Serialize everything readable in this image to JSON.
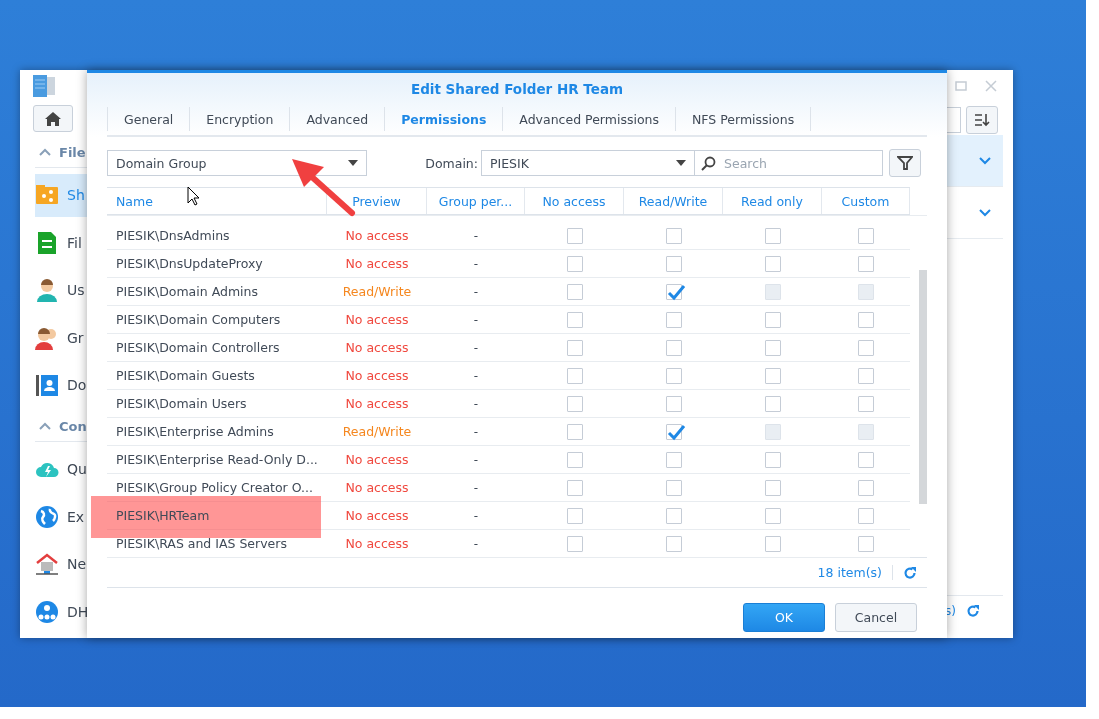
{
  "background_window": {
    "sidebar": [
      {
        "kind": "header",
        "label": "File"
      },
      {
        "kind": "item",
        "label": "Sh",
        "selected": true
      },
      {
        "kind": "item",
        "label": "Fil",
        "selected": false
      },
      {
        "kind": "item",
        "label": "Us",
        "selected": false
      },
      {
        "kind": "item",
        "label": "Gr",
        "selected": false
      },
      {
        "kind": "item",
        "label": "Do",
        "selected": false
      },
      {
        "kind": "header",
        "label": "Con"
      },
      {
        "kind": "item",
        "label": "Qu",
        "selected": false
      },
      {
        "kind": "item",
        "label": "Ex",
        "selected": false
      },
      {
        "kind": "item",
        "label": "Ne",
        "selected": false
      },
      {
        "kind": "item",
        "label": "DH",
        "selected": false
      }
    ],
    "list_rows": [
      {
        "selected": true
      },
      {
        "selected": false
      }
    ],
    "footer_text": "s)"
  },
  "dialog": {
    "title": "Edit Shared Folder HR Team",
    "tabs": [
      {
        "label": "General",
        "selected": false
      },
      {
        "label": "Encryption",
        "selected": false
      },
      {
        "label": "Advanced",
        "selected": false
      },
      {
        "label": "Permissions",
        "selected": true
      },
      {
        "label": "Advanced Permissions",
        "selected": false
      },
      {
        "label": "NFS Permissions",
        "selected": false
      }
    ],
    "type_dropdown": {
      "value": "Domain Group"
    },
    "domain": {
      "label": "Domain:",
      "value": "PIESIK"
    },
    "search": {
      "placeholder": "Search"
    },
    "table": {
      "columns": [
        "Name",
        "Preview",
        "Group per...",
        "No access",
        "Read/Write",
        "Read only",
        "Custom"
      ],
      "rows": [
        {
          "name": "PIESIK\\DnsAdmins",
          "preview": "No access",
          "kind": "none",
          "group": "-",
          "checks": [
            false,
            false,
            false,
            false
          ],
          "highlighted": false
        },
        {
          "name": "PIESIK\\DnsUpdateProxy",
          "preview": "No access",
          "kind": "none",
          "group": "-",
          "checks": [
            false,
            false,
            false,
            false
          ],
          "highlighted": false
        },
        {
          "name": "PIESIK\\Domain Admins",
          "preview": "Read/Write",
          "kind": "rw",
          "group": "-",
          "checks": [
            false,
            true,
            false,
            false
          ],
          "highlighted": false
        },
        {
          "name": "PIESIK\\Domain Computers",
          "preview": "No access",
          "kind": "none",
          "group": "-",
          "checks": [
            false,
            false,
            false,
            false
          ],
          "highlighted": false
        },
        {
          "name": "PIESIK\\Domain Controllers",
          "preview": "No access",
          "kind": "none",
          "group": "-",
          "checks": [
            false,
            false,
            false,
            false
          ],
          "highlighted": false
        },
        {
          "name": "PIESIK\\Domain Guests",
          "preview": "No access",
          "kind": "none",
          "group": "-",
          "checks": [
            false,
            false,
            false,
            false
          ],
          "highlighted": false
        },
        {
          "name": "PIESIK\\Domain Users",
          "preview": "No access",
          "kind": "none",
          "group": "-",
          "checks": [
            false,
            false,
            false,
            false
          ],
          "highlighted": false
        },
        {
          "name": "PIESIK\\Enterprise Admins",
          "preview": "Read/Write",
          "kind": "rw",
          "group": "-",
          "checks": [
            false,
            true,
            false,
            false
          ],
          "highlighted": false
        },
        {
          "name": "PIESIK\\Enterprise Read-Only D...",
          "preview": "No access",
          "kind": "none",
          "group": "-",
          "checks": [
            false,
            false,
            false,
            false
          ],
          "highlighted": false
        },
        {
          "name": "PIESIK\\Group Policy Creator O...",
          "preview": "No access",
          "kind": "none",
          "group": "-",
          "checks": [
            false,
            false,
            false,
            false
          ],
          "highlighted": false
        },
        {
          "name": "PIESIK\\HRTeam",
          "preview": "No access",
          "kind": "none",
          "group": "-",
          "checks": [
            false,
            false,
            false,
            false
          ],
          "highlighted": true
        },
        {
          "name": "PIESIK\\RAS and IAS Servers",
          "preview": "No access",
          "kind": "none",
          "group": "-",
          "checks": [
            false,
            false,
            false,
            false
          ],
          "highlighted": false
        }
      ]
    },
    "item_count": "18 item(s)",
    "buttons": [
      {
        "label": "OK",
        "kind": "primary"
      },
      {
        "label": "Cancel",
        "kind": "secondary"
      }
    ]
  }
}
